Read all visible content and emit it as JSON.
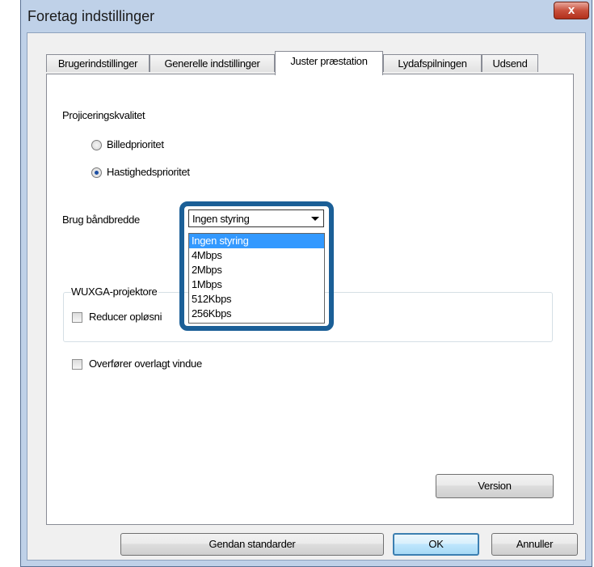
{
  "window": {
    "title": "Foretag indstillinger",
    "close_label": "x"
  },
  "tabs": [
    {
      "label": "Brugerindstillinger"
    },
    {
      "label": "Generelle indstillinger"
    },
    {
      "label": "Juster præstation",
      "active": true
    },
    {
      "label": "Lydafspilningen"
    },
    {
      "label": "Udsend"
    }
  ],
  "projection_quality": {
    "label": "Projiceringskvalitet",
    "options": [
      {
        "label": "Billedprioritet",
        "selected": false
      },
      {
        "label": "Hastighedsprioritet",
        "selected": true
      }
    ]
  },
  "bandwidth": {
    "label": "Brug båndbredde",
    "selected": "Ingen styring",
    "options": [
      "Ingen styring",
      "4Mbps",
      "2Mbps",
      "1Mbps",
      "512Kbps",
      "256Kbps"
    ]
  },
  "wuxga_group": {
    "label": "WUXGA-projektore",
    "checkbox_label": "Reducer opløsni",
    "checked": false
  },
  "transfer_layered": {
    "label": "Overfører overlagt vindue",
    "checked": false
  },
  "buttons": {
    "version": "Version",
    "restore": "Gendan standarder",
    "ok": "OK",
    "cancel": "Annuller"
  },
  "colors": {
    "highlight_frame": "#1b5f97",
    "selected_option": "#3399ff"
  }
}
